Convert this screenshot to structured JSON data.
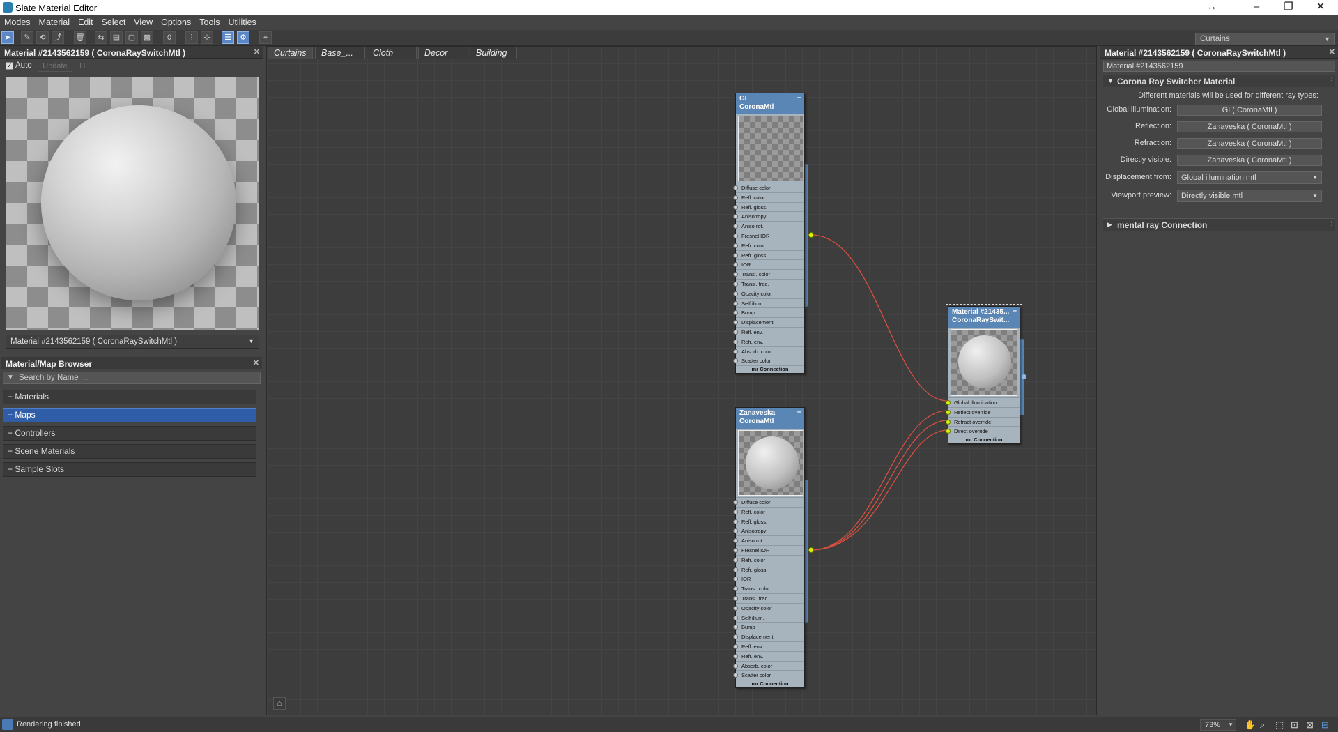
{
  "window": {
    "title": "Slate Material Editor",
    "controls": [
      "resize-arrows-icon",
      "minimize-icon",
      "restore-icon",
      "close-icon"
    ]
  },
  "menubar": [
    "Modes",
    "Material",
    "Edit",
    "Select",
    "View",
    "Options",
    "Tools",
    "Utilities"
  ],
  "view_dropdown": {
    "value": "Curtains"
  },
  "preview_panel": {
    "title": "Material #2143562159  ( CoronaRaySwitchMtl )",
    "auto_label": "Auto",
    "auto_checked": true,
    "update_label": "Update",
    "material_select": "Material #2143562159  ( CoronaRaySwitchMtl )"
  },
  "browser": {
    "title": "Material/Map Browser",
    "search_placeholder": "Search by Name ...",
    "rows": [
      "+ Materials",
      "+ Maps",
      "+ Controllers",
      "+ Scene Materials",
      "+ Sample Slots"
    ],
    "selected": "+ Maps"
  },
  "tabs": [
    "Curtains",
    "Base_...",
    "Cloth",
    "Decor",
    "Building"
  ],
  "active_tab": "Curtains",
  "nodes": {
    "gi": {
      "name": "GI",
      "type": "CoronaMtl",
      "slots": [
        "Diffuse color",
        "Refl. color",
        "Refl. gloss.",
        "Anisotropy",
        "Aniso rot.",
        "Fresnel IOR",
        "Refr. color",
        "Refr. gloss.",
        "IOR",
        "Transl. color",
        "Transl. frac.",
        "Opacity color",
        "Self illum.",
        "Bump",
        "Displacement",
        "Refl. env.",
        "Refr. env.",
        "Absorb. color",
        "Scatter color"
      ],
      "footer": "mr Connection"
    },
    "zanaveska": {
      "name": "Zanaveska",
      "type": "CoronaMtl",
      "slots": [
        "Diffuse color",
        "Refl. color",
        "Refl. gloss.",
        "Anisotropy",
        "Aniso rot.",
        "Fresnel IOR",
        "Refr. color",
        "Refr. gloss.",
        "IOR",
        "Transl. color",
        "Transl. frac.",
        "Opacity color",
        "Self illum.",
        "Bump",
        "Displacement",
        "Refl. env.",
        "Refr. env.",
        "Absorb. color",
        "Scatter color"
      ],
      "footer": "mr Connection"
    },
    "switch": {
      "name": "Material #21435...",
      "type": "CoronaRaySwit...",
      "slots": [
        "Global illumination",
        "Reflect override",
        "Refract override",
        "Direct override"
      ],
      "footer": "mr Connection"
    }
  },
  "params_panel": {
    "title": "Material #2143562159  ( CoronaRaySwitchMtl )",
    "name_field": "Material #2143562159",
    "rollout_title": "Corona Ray Switcher Material",
    "description": "Different materials will be used for different ray types:",
    "params": [
      {
        "label": "Global illumination:",
        "value": "GI  ( CoronaMtl )"
      },
      {
        "label": "Reflection:",
        "value": "Zanaveska  ( CoronaMtl )"
      },
      {
        "label": "Refraction:",
        "value": "Zanaveska  ( CoronaMtl )"
      },
      {
        "label": "Directly visible:",
        "value": "Zanaveska  ( CoronaMtl )"
      }
    ],
    "dropdowns": [
      {
        "label": "Displacement from:",
        "value": "Global illumination mtl"
      },
      {
        "label": "Viewport preview:",
        "value": "Directly visible mtl"
      }
    ],
    "rollout2_title": "mental ray Connection"
  },
  "status": {
    "text": "Rendering finished",
    "zoom": "73%"
  },
  "colors": {
    "wire": "#d9503f",
    "socket_live": "#d6f50a",
    "node_header": "#5a86b5",
    "selected_row": "#2f5da8"
  }
}
